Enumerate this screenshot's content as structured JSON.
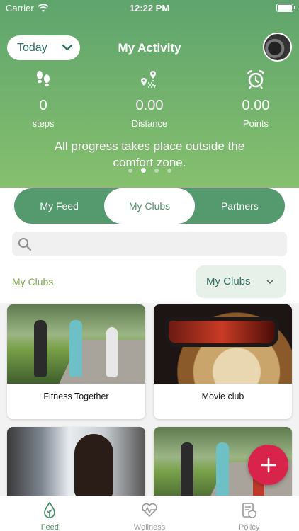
{
  "status_bar": {
    "carrier": "Carrier",
    "time": "12:22 PM"
  },
  "header": {
    "period_selector": "Today",
    "title": "My Activity",
    "stats": [
      {
        "icon": "footsteps-icon",
        "value": "0",
        "label": "steps"
      },
      {
        "icon": "route-icon",
        "value": "0.00",
        "label": "Distance"
      },
      {
        "icon": "alarm-clock-icon",
        "value": "0.00",
        "label": "Points"
      }
    ],
    "quote": "All progress takes place outside the comfort zone.",
    "carousel": {
      "page_count": 4,
      "active_index": 1
    }
  },
  "segments": {
    "tabs": [
      "My Feed",
      "My Clubs",
      "Partners"
    ],
    "active_index": 1
  },
  "search": {
    "placeholder": "",
    "value": ""
  },
  "clubs_section": {
    "label": "My Clubs",
    "filter_selected": "My Clubs",
    "cards": [
      {
        "name": "Fitness Together",
        "image": "runners-photo"
      },
      {
        "name": "Movie club",
        "image": "popcorn-3d-glasses-photo"
      },
      {
        "name": "",
        "image": "woman-reading-photo"
      },
      {
        "name": "",
        "image": "runners-photo"
      }
    ]
  },
  "fab": {
    "icon": "plus-icon"
  },
  "tab_bar": {
    "items": [
      {
        "label": "Feed",
        "icon": "leaf-drop-icon"
      },
      {
        "label": "Wellness",
        "icon": "heart-pulse-icon"
      },
      {
        "label": "Policy",
        "icon": "policy-document-icon"
      }
    ],
    "active_index": 0
  },
  "colors": {
    "header_top": "#5fa46d",
    "header_bottom": "#86c06e",
    "segment_green": "#55996e",
    "accent_text": "#2f6f61",
    "section_label": "#7bab4e",
    "fab": "#d8244b"
  }
}
